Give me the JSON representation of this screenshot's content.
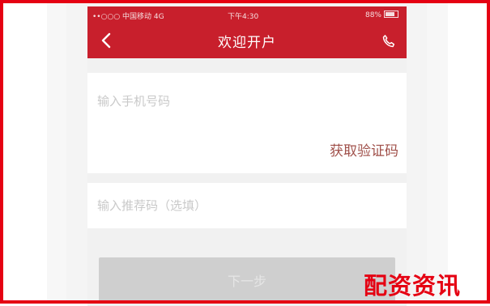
{
  "status_bar": {
    "carrier": "••○○○ 中国移动  4G",
    "time": "下午4:30",
    "battery": "88%"
  },
  "header": {
    "title": "欢迎开户",
    "back_icon": "chevron-left-icon",
    "phone_icon": "phone-icon"
  },
  "form": {
    "phone_placeholder": "输入手机号码",
    "get_code_label": "获取验证码",
    "referrer_placeholder": "输入推荐码（选填）",
    "submit_label": "下一步"
  },
  "watermark": "配资资讯",
  "colors": {
    "header": "#c81f2c",
    "frame": "#e50012",
    "code_link": "#a0504a"
  }
}
